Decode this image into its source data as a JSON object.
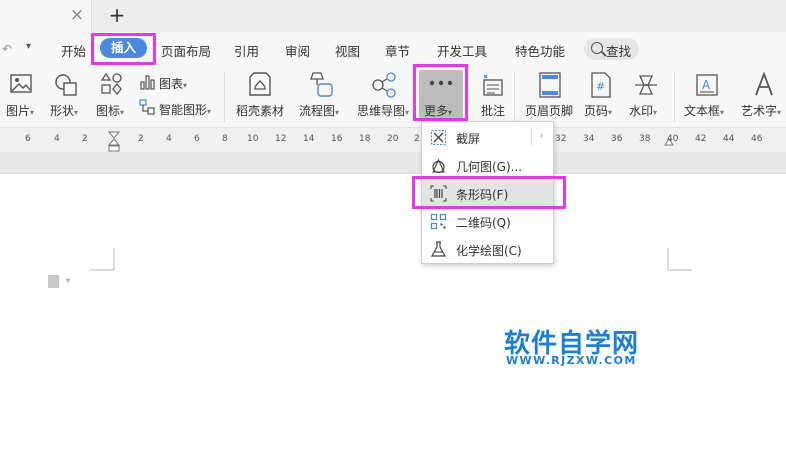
{
  "tabbar": {
    "close_glyph": "×",
    "new_tab_glyph": "+"
  },
  "toolbar_quick": {
    "undo_glyph": "↶",
    "customize_glyph": "▾"
  },
  "menu": {
    "items": [
      "开始",
      "插入",
      "页面布局",
      "引用",
      "审阅",
      "视图",
      "章节",
      "开发工具",
      "特色功能"
    ],
    "active": "插入",
    "search_label": "查找"
  },
  "ribbon": {
    "tools": [
      {
        "label": "图片",
        "icon": "picture-icon",
        "dropdown": true
      },
      {
        "label": "形状",
        "icon": "shapes-icon",
        "dropdown": true
      },
      {
        "label": "图标",
        "icon": "icons-icon",
        "dropdown": true
      },
      {
        "label": "图表",
        "icon": "chart-icon",
        "dropdown": true
      },
      {
        "label": "智能图形",
        "icon": "smartart-icon",
        "dropdown": true
      },
      {
        "label": "稻壳素材",
        "icon": "material-icon",
        "dropdown": false
      },
      {
        "label": "流程图",
        "icon": "flowchart-icon",
        "dropdown": true
      },
      {
        "label": "思维导图",
        "icon": "mindmap-icon",
        "dropdown": true
      },
      {
        "label": "更多",
        "icon": "more-icon",
        "dropdown": true
      },
      {
        "label": "批注",
        "icon": "comment-icon",
        "dropdown": false
      },
      {
        "label": "页眉页脚",
        "icon": "header-footer-icon",
        "dropdown": false
      },
      {
        "label": "页码",
        "icon": "page-number-icon",
        "dropdown": true
      },
      {
        "label": "水印",
        "icon": "watermark-icon",
        "dropdown": true
      },
      {
        "label": "文本框",
        "icon": "textbox-icon",
        "dropdown": true
      },
      {
        "label": "艺术字",
        "icon": "wordart-icon",
        "dropdown": true
      }
    ],
    "dropdown_glyph": "▾"
  },
  "ruler": {
    "ticks": [
      "6",
      "4",
      "2",
      "2",
      "4",
      "6",
      "8",
      "10",
      "12",
      "14",
      "16",
      "18",
      "20",
      "2",
      "32",
      "34",
      "36",
      "38",
      "40",
      "42",
      "44",
      "46"
    ]
  },
  "more_menu": {
    "items": [
      {
        "label": "截屏",
        "icon": "screenshot-icon",
        "submenu": true
      },
      {
        "label": "几何图(G)...",
        "icon": "geometry-icon",
        "submenu": false
      },
      {
        "label": "条形码(F)",
        "icon": "barcode-icon",
        "submenu": false,
        "highlighted": true
      },
      {
        "label": "二维码(Q)",
        "icon": "qrcode-icon",
        "submenu": false
      },
      {
        "label": "化学绘图(C)",
        "icon": "chemistry-icon",
        "submenu": false
      }
    ],
    "submenu_glyph": "›"
  },
  "watermark": {
    "title": "软件自学网",
    "url": "WWW.RJZXW.COM"
  },
  "colors": {
    "highlight": "#e23ae5",
    "accent": "#4a89dc",
    "watermark": "#1d7fd4"
  }
}
